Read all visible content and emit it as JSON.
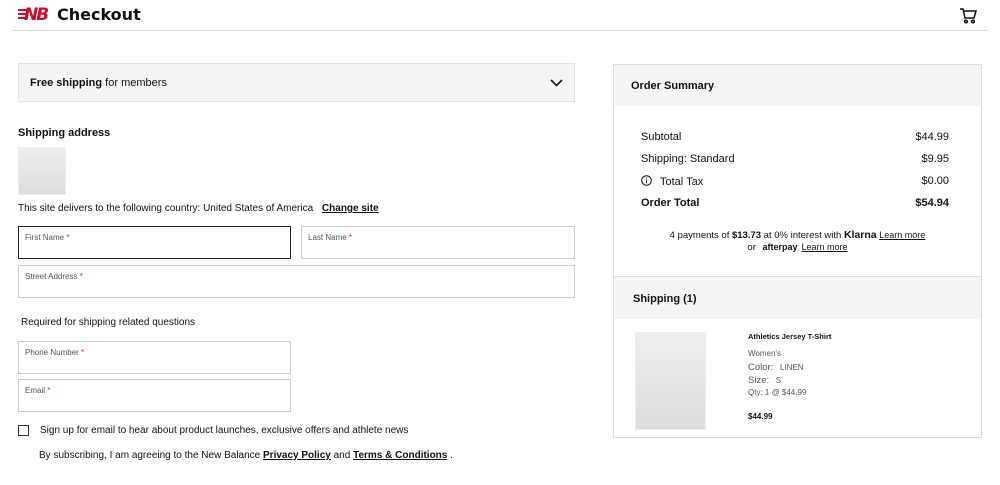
{
  "header": {
    "logo": "NB",
    "title": "Checkout",
    "cart_icon": "cart-icon"
  },
  "promo": {
    "bold": "Free shipping",
    "rest": " for members",
    "icon": "chevron-down-icon"
  },
  "shipping": {
    "heading": "Shipping address",
    "delivers": "This site delivers to the following country: United States of America",
    "change_site": "Change site",
    "first_name": "First Name",
    "last_name": "Last Name",
    "street": "Street Address",
    "req": " *",
    "required_note": "Required for shipping related questions",
    "phone": "Phone Number",
    "email": "Email",
    "signup": "Sign up for email to hear about product launches, exclusive offers and athlete news",
    "agree_pre": "By subscribing, I am agreeing to the New Balance ",
    "privacy": "Privacy Policy",
    "and": " and ",
    "terms": "Terms & Conditions",
    "end": " ."
  },
  "summary": {
    "title": "Order Summary",
    "rows": [
      {
        "label": "Subtotal",
        "value": "$44.99"
      },
      {
        "label": "Shipping: Standard",
        "value": "$9.95"
      },
      {
        "label": "Total Tax",
        "value": "$0.00"
      },
      {
        "label": "Order Total",
        "value": "$54.94"
      }
    ],
    "klarna_pre": "4 payments of ",
    "klarna_amt": "$13.73",
    "klarna_mid": " at 0% interest with ",
    "klarna": "Klarna",
    "learn": "Learn more",
    "or": "or",
    "afterpay": "afterpay"
  },
  "cart": {
    "title": "Shipping (1)",
    "item": {
      "name": "Athletics Jersey T-Shirt",
      "gender": "Women's",
      "color_label": "Color:",
      "color": "LINEN",
      "size_label": "Size:",
      "size": "S",
      "qty": "Qty:  1 @ $44.99",
      "price": "$44.99"
    }
  }
}
